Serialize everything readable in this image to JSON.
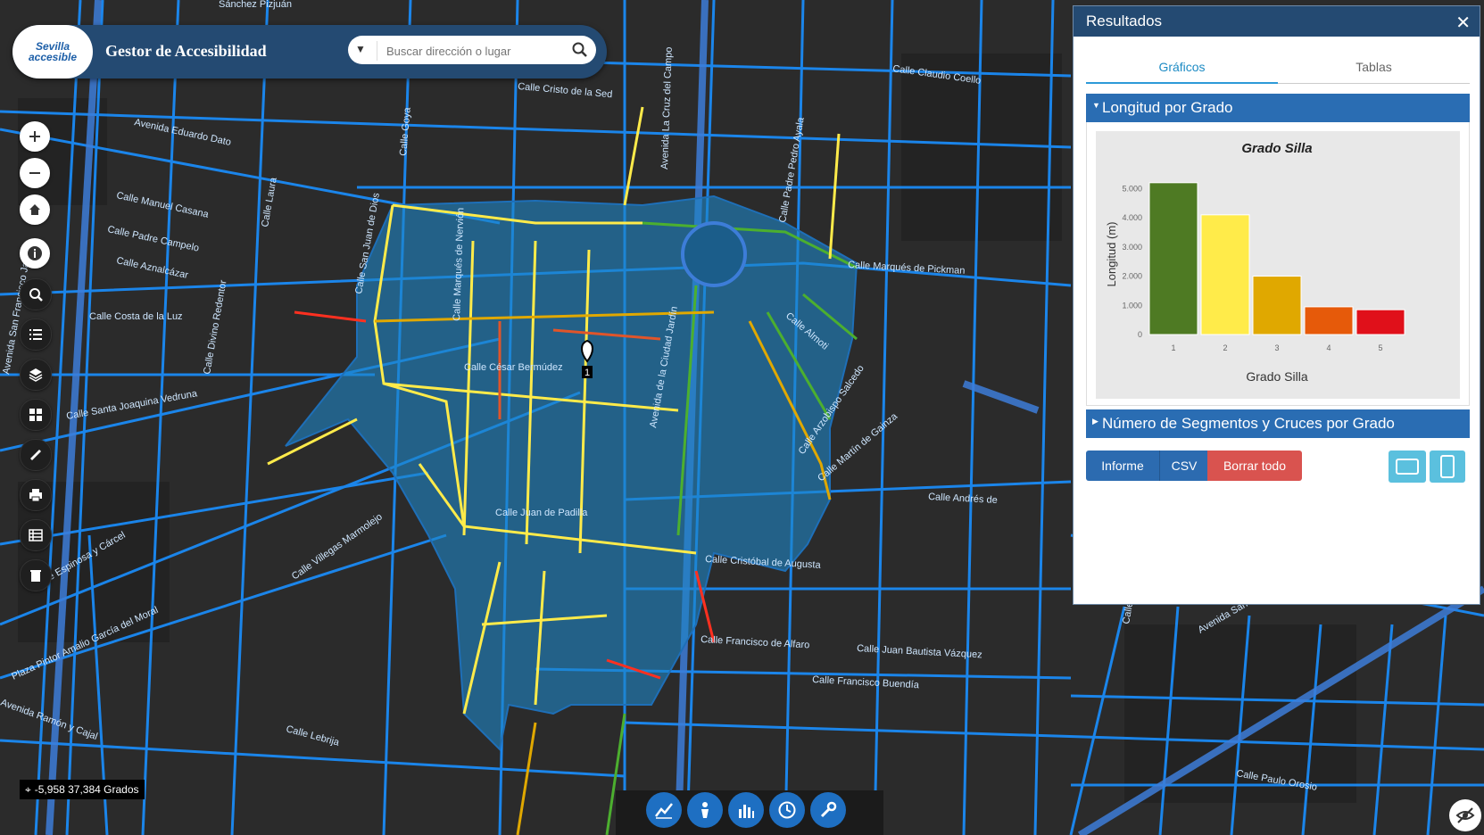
{
  "app": {
    "title": "Gestor de Accesibilidad",
    "logo_text": "Sevilla accesible"
  },
  "search": {
    "placeholder": "Buscar dirección o lugar"
  },
  "map": {
    "street_labels": [
      "Avenida Eduardo Dato",
      "Calle Manuel Casana",
      "Calle Padre Campelo",
      "Calle Aznalcázar",
      "Calle Costa de la Luz",
      "Calle Santa Joaquina Vedruna",
      "Calle Espinosa y Cárcel",
      "Calle Villegas Marmolejo",
      "Avenida de la Ciudad Jardín",
      "Avenida La Cruz del Campo",
      "Calle Marqués de Pickman",
      "Calle Cristo de la Sed",
      "Calle Claudio Coello",
      "Calle Almoti",
      "Calle Cristóbal de Augusta",
      "Calle Francisco de Alfaro",
      "Calle Francisco Buendía",
      "Calle Juan de Padilla",
      "Calle César Bermúdez",
      "Calle Marqués de Nervión",
      "Calle Lebrija",
      "Avenida Ramón y Cajal",
      "Calle Juan Bautista Vázquez",
      "Avenida San Juan de la Salle",
      "Calle Padre Pedro Ayala",
      "Calle Andrés de",
      "Calle Martín de Gainza",
      "Calle Arzobispo Salcedo",
      "Avenida San Francisco Javier",
      "Calle Divino Redentor",
      "Calle San Juan de Dios",
      "Calle Goya",
      "Calle Laura",
      "Sánchez Pizjuán",
      "Plaza Pintor Amalio García del Moral",
      "Calle Paulo Orosio",
      "Calle Esteban"
    ],
    "marker_label": "1",
    "coordinates": "-5,958 37,384 Grados"
  },
  "toolbar_icons": [
    "plus-icon",
    "minus-icon",
    "home-icon",
    "info-icon",
    "search-icon",
    "list-icon",
    "layers-icon",
    "grid-icon",
    "ruler-icon",
    "print-icon",
    "table-icon",
    "trash-icon"
  ],
  "bottom_tools": [
    "line-chart-icon",
    "person-icon",
    "bar-chart-icon",
    "clock-icon",
    "wrench-icon"
  ],
  "panel": {
    "title": "Resultados",
    "close": "✕",
    "tabs": [
      {
        "label": "Gráficos",
        "active": true
      },
      {
        "label": "Tablas",
        "active": false
      }
    ],
    "sections": [
      {
        "label": "Longitud por Grado",
        "expanded": true
      },
      {
        "label": "Número de Segmentos y Cruces por Grado",
        "expanded": false
      }
    ],
    "buttons": {
      "report": "Informe",
      "csv": "CSV",
      "clear": "Borrar todo"
    },
    "colors": {
      "header": "#244a72",
      "accordion": "#2a6db3",
      "report_btn": "#2c6bb0",
      "clear_btn": "#d9534f",
      "view_btn": "#5bc0de"
    }
  },
  "chart_data": {
    "type": "bar",
    "title": "Grado Silla",
    "xlabel": "Grado Silla",
    "ylabel": "Longitud (m)",
    "categories": [
      "1",
      "2",
      "3",
      "4",
      "5"
    ],
    "values": [
      5200,
      4100,
      2000,
      950,
      850
    ],
    "colors": [
      "#4e7a23",
      "#ffeb4a",
      "#e0a800",
      "#e65a0a",
      "#e0101a"
    ],
    "yticks": [
      "0",
      "1.000",
      "2.000",
      "3.000",
      "4.000",
      "5.000"
    ],
    "ylim": [
      0,
      5500
    ],
    "grid": false
  }
}
